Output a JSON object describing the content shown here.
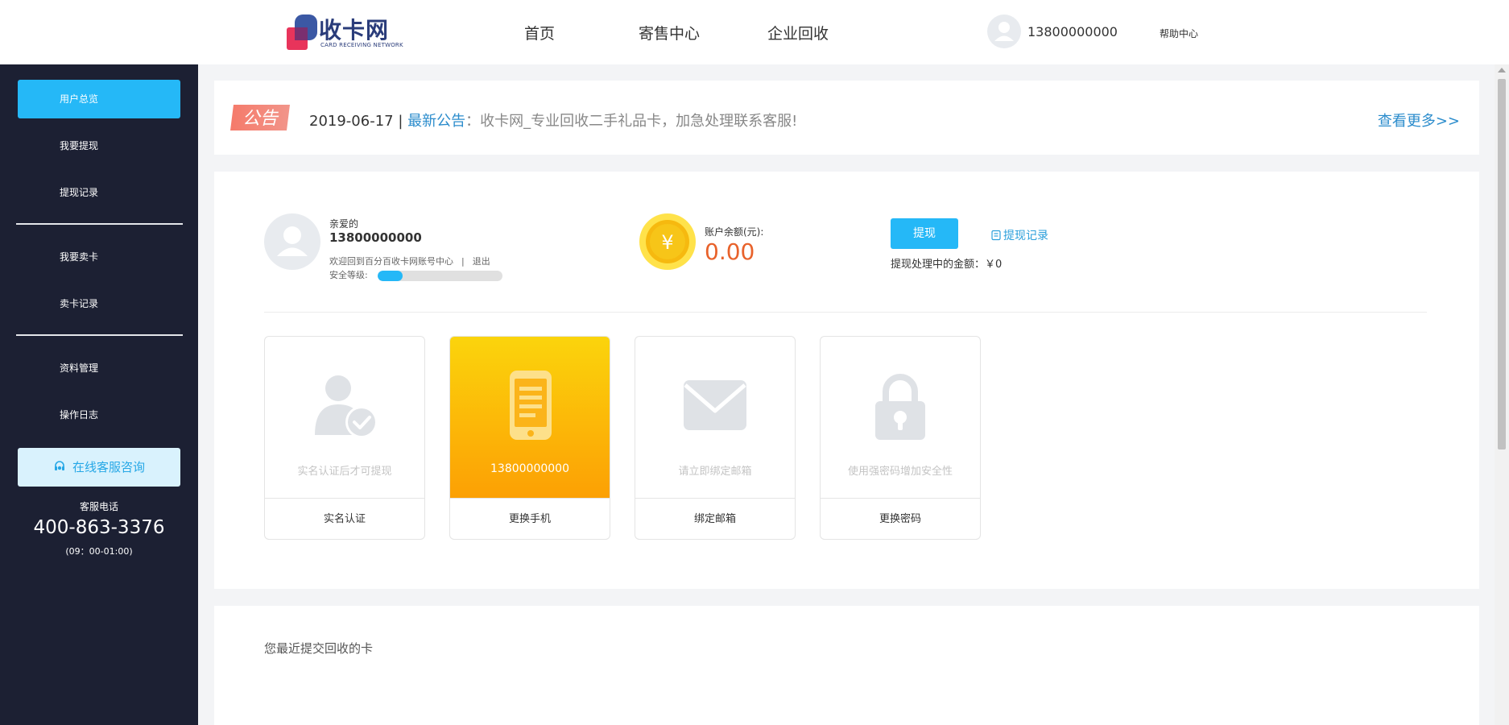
{
  "header": {
    "logo_text": "收卡网",
    "logo_subtext": "CARD RECEIVING NETWORK",
    "nav": [
      "首页",
      "寄售中心",
      "企业回收"
    ],
    "user_phone": "13800000000",
    "help_label": "帮助中心"
  },
  "sidebar": {
    "items": [
      {
        "label": "用户总览",
        "active": true
      },
      {
        "label": "我要提现",
        "active": false
      },
      {
        "label": "提现记录",
        "active": false
      },
      {
        "label": "我要卖卡",
        "active": false
      },
      {
        "label": "卖卡记录",
        "active": false
      },
      {
        "label": "资料管理",
        "active": false
      },
      {
        "label": "操作日志",
        "active": false
      }
    ],
    "service_button": "在线客服咨询",
    "tel_label": "客服电话",
    "tel": "400-863-3376",
    "hours": "(09：00-01:00)"
  },
  "notice": {
    "badge": "公告",
    "date": "2019-06-17 |",
    "tag": "最新公告",
    "colon": "：",
    "text": "收卡网_专业回收二手礼品卡，加急处理联系客服!",
    "more": "查看更多>>"
  },
  "profile": {
    "dear": "亲爱的",
    "phone": "13800000000",
    "welcome": "欢迎回到百分百收卡网账号中心",
    "separator": "|",
    "logout": "退出",
    "security_label": "安全等级:",
    "security_level": 0.2
  },
  "balance": {
    "coin_symbol": "¥",
    "label": "账户余额(元):",
    "value": "0.00"
  },
  "withdraw": {
    "button": "提现",
    "records_link": "提现记录",
    "pending_label": "提现处理中的金额：",
    "pending_value": "￥0"
  },
  "cards": [
    {
      "desc": "实名认证后才可提现",
      "label": "实名认证",
      "icon": "user-verified-icon"
    },
    {
      "desc": "13800000000",
      "label": "更换手机",
      "icon": "phone-icon"
    },
    {
      "desc": "请立即绑定邮箱",
      "label": "绑定邮箱",
      "icon": "mail-icon"
    },
    {
      "desc": "使用强密码增加安全性",
      "label": "更换密码",
      "icon": "lock-icon"
    }
  ],
  "recent": {
    "title": "您最近提交回收的卡"
  },
  "colors": {
    "accent": "#25b8f7",
    "sidebar_bg": "#1c2033",
    "balance": "#e8622b",
    "link": "#2b8ccc"
  }
}
